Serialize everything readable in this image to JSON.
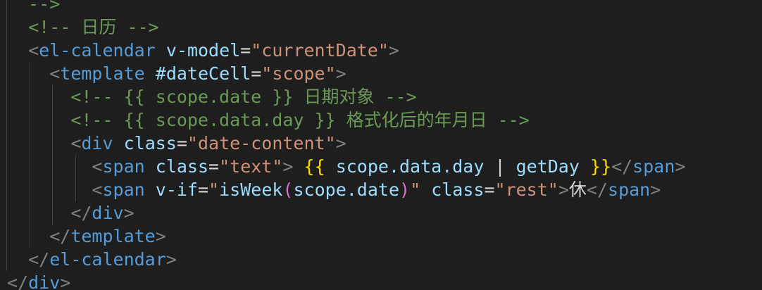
{
  "editor": {
    "indent_unit": "  ",
    "colors": {
      "background": "#1e1e1e",
      "comment": "#6a9955",
      "tag": "#569cd6",
      "attribute": "#9cdcfe",
      "string": "#ce9178",
      "punctuation": "#808080",
      "text": "#d4d4d4",
      "brace": "#ffd700",
      "paren": "#da70d6",
      "indent_guide": "#404040"
    },
    "lines": [
      {
        "indent": 1,
        "tokens": [
          {
            "t": "-->",
            "c": "comment"
          }
        ]
      },
      {
        "indent": 1,
        "tokens": [
          {
            "t": "<!-- 日历 -->",
            "c": "comment"
          }
        ]
      },
      {
        "indent": 1,
        "tokens": [
          {
            "t": "<",
            "c": "punct"
          },
          {
            "t": "el-calendar",
            "c": "tag"
          },
          {
            "t": " ",
            "c": "text"
          },
          {
            "t": "v-model",
            "c": "attr"
          },
          {
            "t": "=",
            "c": "text"
          },
          {
            "t": "\"currentDate\"",
            "c": "str"
          },
          {
            "t": ">",
            "c": "punct"
          }
        ]
      },
      {
        "indent": 2,
        "tokens": [
          {
            "t": "<",
            "c": "punct"
          },
          {
            "t": "template",
            "c": "tag"
          },
          {
            "t": " ",
            "c": "text"
          },
          {
            "t": "#dateCell",
            "c": "attr"
          },
          {
            "t": "=",
            "c": "text"
          },
          {
            "t": "\"scope\"",
            "c": "str"
          },
          {
            "t": ">",
            "c": "punct"
          }
        ]
      },
      {
        "indent": 3,
        "tokens": [
          {
            "t": "<!-- {{ scope.date }} 日期对象 -->",
            "c": "comment"
          }
        ]
      },
      {
        "indent": 3,
        "tokens": [
          {
            "t": "<!-- {{ scope.data.day }} 格式化后的年月日 -->",
            "c": "comment"
          }
        ]
      },
      {
        "indent": 3,
        "tokens": [
          {
            "t": "<",
            "c": "punct"
          },
          {
            "t": "div",
            "c": "tag"
          },
          {
            "t": " ",
            "c": "text"
          },
          {
            "t": "class",
            "c": "attr"
          },
          {
            "t": "=",
            "c": "text"
          },
          {
            "t": "\"date-content\"",
            "c": "str"
          },
          {
            "t": ">",
            "c": "punct"
          }
        ]
      },
      {
        "indent": 4,
        "tokens": [
          {
            "t": "<",
            "c": "punct"
          },
          {
            "t": "span",
            "c": "tag"
          },
          {
            "t": " ",
            "c": "text"
          },
          {
            "t": "class",
            "c": "attr"
          },
          {
            "t": "=",
            "c": "text"
          },
          {
            "t": "\"text\"",
            "c": "str"
          },
          {
            "t": ">",
            "c": "punct"
          },
          {
            "t": " ",
            "c": "text"
          },
          {
            "t": "{{",
            "c": "brace"
          },
          {
            "t": " scope.data.day ",
            "c": "var"
          },
          {
            "t": "|",
            "c": "op"
          },
          {
            "t": " getDay ",
            "c": "var"
          },
          {
            "t": "}}",
            "c": "brace"
          },
          {
            "t": "</",
            "c": "punct"
          },
          {
            "t": "span",
            "c": "tag"
          },
          {
            "t": ">",
            "c": "punct"
          }
        ]
      },
      {
        "indent": 4,
        "tokens": [
          {
            "t": "<",
            "c": "punct"
          },
          {
            "t": "span",
            "c": "tag"
          },
          {
            "t": " ",
            "c": "text"
          },
          {
            "t": "v-if",
            "c": "attr"
          },
          {
            "t": "=",
            "c": "text"
          },
          {
            "t": "\"",
            "c": "str"
          },
          {
            "t": "isWeek",
            "c": "var"
          },
          {
            "t": "(",
            "c": "paren"
          },
          {
            "t": "scope.date",
            "c": "var"
          },
          {
            "t": ")",
            "c": "paren"
          },
          {
            "t": "\"",
            "c": "str"
          },
          {
            "t": " ",
            "c": "text"
          },
          {
            "t": "class",
            "c": "attr"
          },
          {
            "t": "=",
            "c": "text"
          },
          {
            "t": "\"rest\"",
            "c": "str"
          },
          {
            "t": ">",
            "c": "punct"
          },
          {
            "t": "休",
            "c": "text"
          },
          {
            "t": "</",
            "c": "punct"
          },
          {
            "t": "span",
            "c": "tag"
          },
          {
            "t": ">",
            "c": "punct"
          }
        ]
      },
      {
        "indent": 3,
        "tokens": [
          {
            "t": "</",
            "c": "punct"
          },
          {
            "t": "div",
            "c": "tag"
          },
          {
            "t": ">",
            "c": "punct"
          }
        ]
      },
      {
        "indent": 2,
        "tokens": [
          {
            "t": "</",
            "c": "punct"
          },
          {
            "t": "template",
            "c": "tag"
          },
          {
            "t": ">",
            "c": "punct"
          }
        ]
      },
      {
        "indent": 1,
        "tokens": [
          {
            "t": "</",
            "c": "punct"
          },
          {
            "t": "el-calendar",
            "c": "tag"
          },
          {
            "t": ">",
            "c": "punct"
          }
        ]
      },
      {
        "indent": 0,
        "tokens": [
          {
            "t": "</",
            "c": "punct"
          },
          {
            "t": "div",
            "c": "tag"
          },
          {
            "t": ">",
            "c": "punct"
          }
        ]
      }
    ]
  }
}
